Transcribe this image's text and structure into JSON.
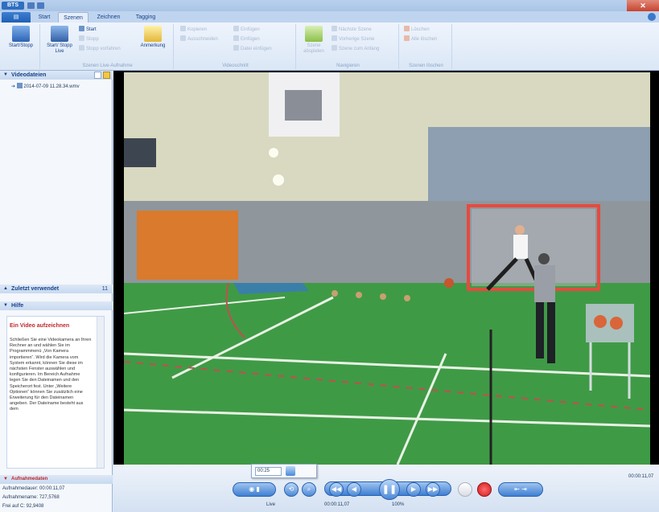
{
  "titlebar": {
    "logo": "BTS",
    "close": "✕"
  },
  "ribbon_tabs": [
    "Start",
    "Szenen",
    "Zeichnen",
    "Tagging"
  ],
  "ribbon": {
    "groups": [
      {
        "label": "",
        "buttons": [
          "Start/Stopp"
        ]
      },
      {
        "label": "Szenen Live-Aufnahme",
        "buttons": [
          "Start/ Stopp Live",
          "Start",
          "Stopp",
          "Stopp vorfahren",
          "Anmerkung"
        ]
      },
      {
        "label": "Videoschnitt",
        "buttons": [
          "Kopieren",
          "Ausschneiden",
          "Einfügen",
          "Einfügen",
          "Datei einfügen"
        ]
      },
      {
        "label": "Navigieren",
        "buttons": [
          "Szene abspielen",
          "Nächste Szene",
          "Vorherige Szene",
          "Szene zum Anfang"
        ]
      },
      {
        "label": "Szenen löschen",
        "buttons": [
          "Löschen",
          "Alle löschen"
        ]
      }
    ]
  },
  "leftpanel": {
    "videodateien_title": "Videodateien",
    "file_name": "2014-07-09 11.28.34.wmv",
    "recent_title": "Zuletzt verwendet",
    "recent_count": "11",
    "help_title": "Hilfe",
    "help_heading": "Ein Video aufzeichnen",
    "help_text": "Schließen Sie eine Videokamera an Ihren Rechner an und wählen Sie im Programmmenü „Von Kamera importieren“. Wird die Kamera vom System erkannt, können Sie diese im nächsten Fenster auswählen und konfigurieren. Im Bereich Aufnahme legen Sie den Dateinamen und den Speicherort fest. Unter „Weitere Optionen“ können Sie zusätzlich eine Erweiterung für den Dateinamen angeben. Der Dateiname besteht aus dem",
    "aufnahme_title": "Aufnahmedaten",
    "aufnahme_lines": [
      "Aufnahmedauer: 00:00:11,07",
      "Aufnahmename: 727,5768",
      "Frei auf C: 92,9408"
    ]
  },
  "controls": {
    "popup_time": "00:25",
    "live_label": "Live",
    "timecode": "00:00:11,07",
    "zoom": "100%",
    "timecode_right": "00:00:11,07",
    "buttons": [
      "◀◀",
      "◀",
      "▶",
      "▶▶"
    ]
  },
  "colors": {
    "accent": "#3f7fd1",
    "record": "#e0202a",
    "help_heading": "#c0282d"
  }
}
